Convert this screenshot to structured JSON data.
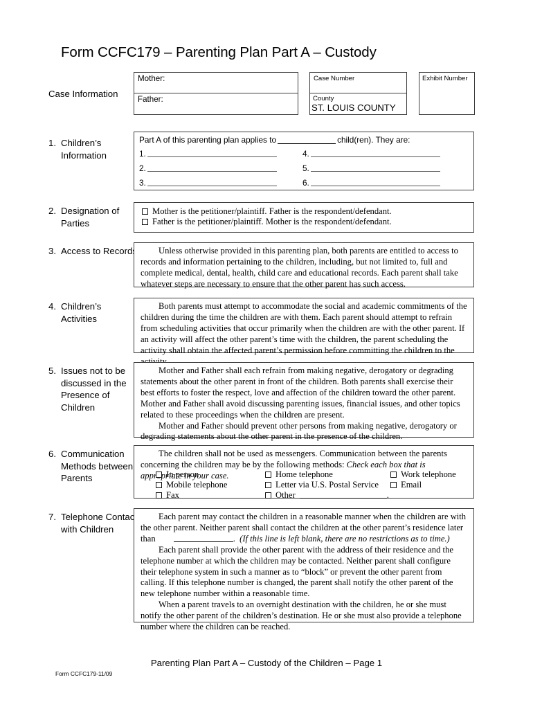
{
  "document": {
    "title": "Form CCFC179 – Parenting Plan Part A – Custody"
  },
  "case_information": {
    "label": "Case Information",
    "mother_label": "Mother:",
    "father_label": "Father:",
    "case_number_label": "Case Number",
    "county_label": "County",
    "county_value": "ST. LOUIS COUNTY",
    "exhibit_number_label": "Exhibit Number"
  },
  "sections": [
    {
      "number": "1.",
      "label": "Children’s Information",
      "lead_before": "Part A of this parenting plan applies to",
      "lead_after": "child(ren).  They are:",
      "child_items": [
        "1.",
        "2.",
        "3.",
        "4.",
        "5.",
        "6."
      ]
    },
    {
      "number": "2.",
      "label": "Designation of Parties",
      "checkboxes": [
        "Mother is the petitioner/plaintiff.  Father is the respondent/defendant.",
        "Father is the petitioner/plaintiff.  Mother is the respondent/defendant."
      ]
    },
    {
      "number": "3.",
      "label": "Access to Records",
      "paragraphs": [
        "Unless otherwise provided in this parenting plan, both parents are entitled to access to records and information pertaining to the children, including, but not limited to, full and complete medical, dental, health, child care and educational records.  Each parent shall take whatever steps are necessary to ensure that the other parent has such access."
      ]
    },
    {
      "number": "4.",
      "label": "Children’s Activities",
      "paragraphs": [
        "Both parents must attempt to accommodate the social and academic commitments of the children during the time the children are with them.  Each parent should attempt to refrain from scheduling activities that occur primarily when the children are with the other parent.  If an activity will affect the other parent’s time with the children, the parent scheduling the activity shall obtain the affected parent’s permission before committing the children to the activity."
      ]
    },
    {
      "number": "5.",
      "label": "Issues not to be discussed in the Presence of Children",
      "paragraphs": [
        "Mother and Father shall each refrain from making negative, derogatory or degrading statements about the other parent in front of the children.  Both parents shall exercise their best efforts to foster the respect, love and affection of the children toward the other parent.  Mother and Father shall avoid discussing parenting issues, financial issues, and other topics related to these proceedings when the children are present.",
        "Mother and Father should prevent other persons from making negative, derogatory or degrading statements about the other parent in the presence of the children."
      ]
    },
    {
      "number": "6.",
      "label": "Communication Methods between Parents",
      "lead": "The children shall not be used as messengers.  Communication between the parents concerning the children may be by the following methods:",
      "lead_italic": "Check each box that is appropriate in your case.",
      "methods": [
        "In person",
        "Mobile telephone",
        "Fax",
        "Home telephone",
        "Letter via U.S. Postal Service",
        "Other",
        "Work telephone",
        "Email"
      ],
      "other_suffix": "."
    },
    {
      "number": "7.",
      "label": "Telephone Contact with Children",
      "para1_before": "Each parent may contact the children in a reasonable manner when the children are with the other parent.  Neither parent shall contact the children at the other parent’s residence later than",
      "para1_after": ".",
      "para1_italic": "(If this line is left blank, there are no restrictions as to time.)",
      "para2": "Each parent shall provide the other parent with the address of their residence and the telephone number at which the children may be contacted.  Neither parent shall configure their telephone system in such a manner as to “block” or prevent the other parent from calling.  If this telephone number is changed, the parent shall notify the other parent of the new telephone number within a reasonable time.",
      "para3": "When a parent travels to an overnight destination with the children, he or she must notify the other parent of the children’s destination.  He or she must also provide a telephone number where the children can be reached."
    }
  ],
  "footer": {
    "center": "Parenting Plan Part A – Custody of the Children – Page 1",
    "form_id": "Form CCFC179-11/09"
  }
}
